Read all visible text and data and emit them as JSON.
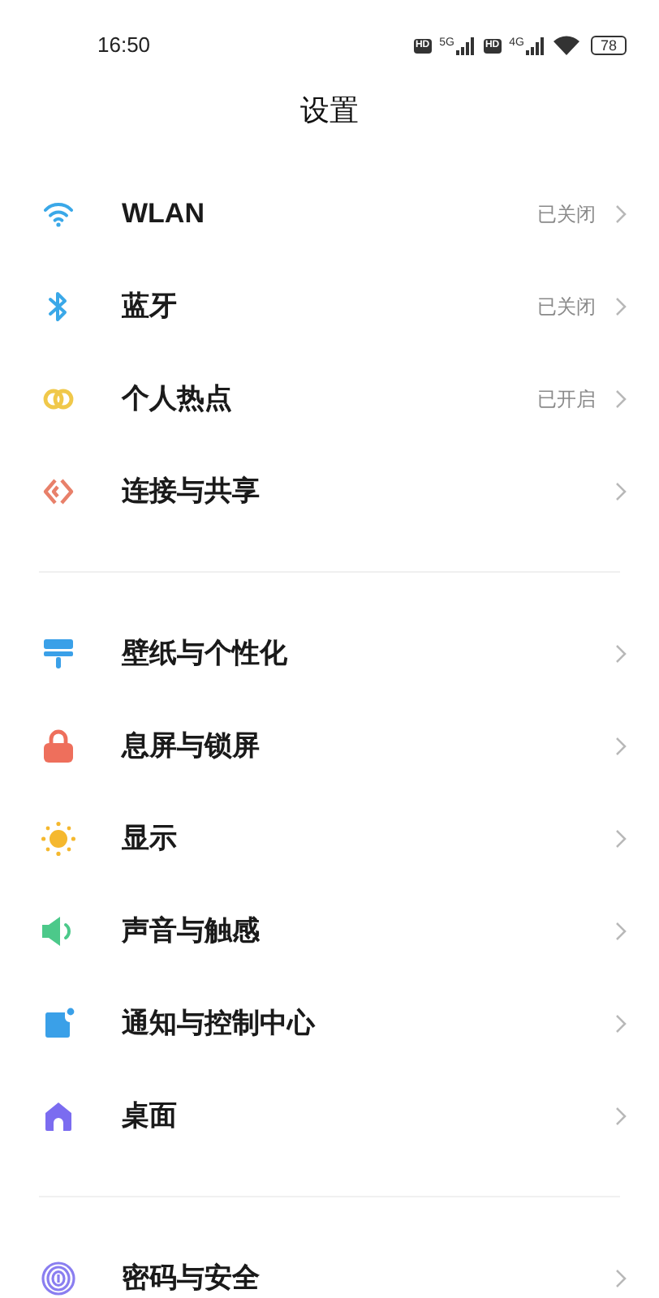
{
  "status_bar": {
    "time": "16:50",
    "sim_1": {
      "badge": "HD",
      "network": "5G"
    },
    "sim_2": {
      "badge": "HD",
      "network": "4G"
    },
    "battery": "78"
  },
  "title": "设置",
  "groups": [
    {
      "items": [
        {
          "kind": "wifi",
          "label": "WLAN",
          "value": "已关闭"
        },
        {
          "kind": "bluetooth",
          "label": "蓝牙",
          "value": "已关闭"
        },
        {
          "kind": "hotspot",
          "label": "个人热点",
          "value": "已开启"
        },
        {
          "kind": "share",
          "label": "连接与共享"
        }
      ]
    },
    {
      "items": [
        {
          "kind": "wallpaper",
          "label": "壁纸与个性化"
        },
        {
          "kind": "lock",
          "label": "息屏与锁屏"
        },
        {
          "kind": "sun",
          "label": "显示"
        },
        {
          "kind": "speaker",
          "label": "声音与触感"
        },
        {
          "kind": "notification",
          "label": "通知与控制中心"
        },
        {
          "kind": "home",
          "label": "桌面"
        }
      ]
    },
    {
      "items": [
        {
          "kind": "fingerprint",
          "label": "密码与安全"
        }
      ]
    }
  ]
}
